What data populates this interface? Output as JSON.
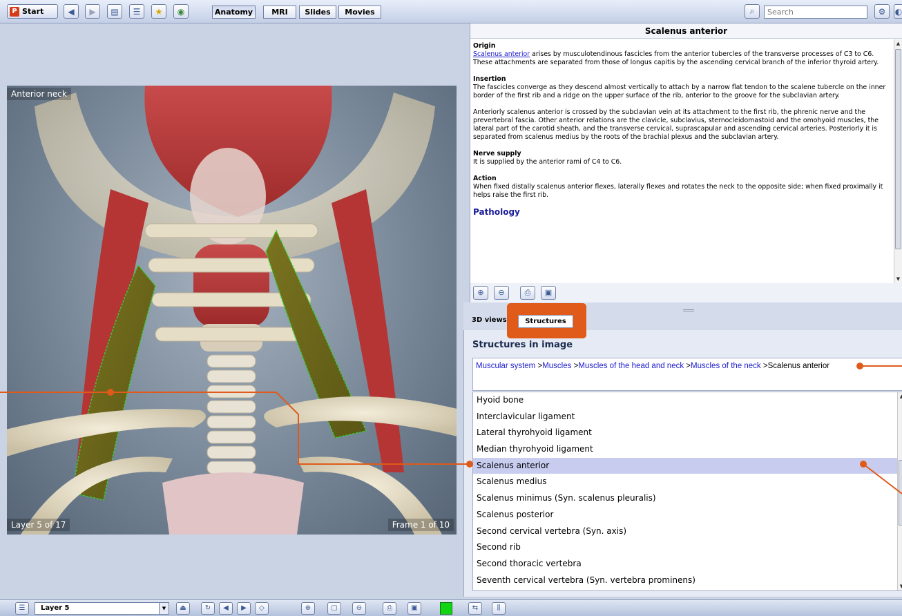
{
  "toolbar": {
    "start_label": "Start",
    "logo_letter": "P",
    "tabs": [
      "Anatomy",
      "MRI",
      "Slides",
      "Movies"
    ],
    "active_tab": "Anatomy",
    "search_placeholder": "Search"
  },
  "viewer": {
    "view_label": "Anterior neck",
    "layer_label": "Layer 5 of 17",
    "frame_label": "Frame 1 of 10"
  },
  "description": {
    "title": "Scalenus anterior",
    "origin_heading": "Origin",
    "origin_link": "Scalenus anterior",
    "origin_text": " arises by musculotendinous fascicles from the anterior tubercles of the transverse processes of C3 to C6. These attachments are separated from those of longus capitis by the ascending cervical branch of the inferior thyroid artery.",
    "insertion_heading": "Insertion",
    "insertion_text": "The fascicles converge as they descend almost vertically to attach by a narrow flat tendon to the scalene tubercle on the inner border of the first rib and a ridge on the upper surface of the rib, anterior to the groove for the subclavian artery.",
    "relations_text": "Anteriorly scalenus anterior is crossed by the subclavian vein at its attachment to the first rib, the phrenic nerve and the prevertebral fascia. Other anterior relations are the clavicle, subclavius, sternocleidomastoid and the omohyoid muscles, the lateral part of the carotid sheath, and the transverse cervical, suprascapular and ascending cervical arteries. Posteriorly it is separated from scalenus medius by the roots of the brachial plexus and the subclavian artery.",
    "nerve_heading": "Nerve supply",
    "nerve_text": "It is supplied by the anterior rami of C4 to C6.",
    "action_heading": "Action",
    "action_text": "When fixed distally scalenus anterior flexes, laterally flexes and rotates the neck to the opposite side; when fixed proximally it helps raise the first rib.",
    "pathology_heading": "Pathology"
  },
  "panel_tabs": {
    "views_label": "3D views",
    "structures_label": "Structures"
  },
  "structures": {
    "heading": "Structures in image",
    "breadcrumb": [
      "Muscular system",
      "Muscles",
      "Muscles of the head and neck",
      "Muscles of the neck",
      "Scalenus anterior"
    ],
    "selected": "Scalenus anterior",
    "items": [
      "Hyoid bone",
      "Interclavicular ligament",
      "Lateral thyrohyoid ligament",
      "Median thyrohyoid ligament",
      "Scalenus anterior",
      "Scalenus medius",
      "Scalenus minimus (Syn. scalenus pleuralis)",
      "Scalenus posterior",
      "Second cervical vertebra (Syn. axis)",
      "Second rib",
      "Second thoracic vertebra",
      "Seventh cervical vertebra (Syn. vertebra prominens)"
    ]
  },
  "bottom": {
    "layer_label": "Layer 5"
  },
  "colors": {
    "highlight": "#e05a19",
    "selected_row": "#c8cdf0",
    "link": "#1a1acc",
    "muscle_highlight": "#6b6a1c"
  },
  "icons": {
    "toolbar": [
      "back-arrow-icon",
      "forward-arrow-icon",
      "document-icon",
      "list-icon",
      "star-icon",
      "globe-icon"
    ],
    "search": "magnifier-icon",
    "settings": "gear-icon",
    "description_tools": [
      "zoom-in-icon",
      "zoom-out-icon",
      "print-icon",
      "save-icon"
    ],
    "bottom": [
      "menu-icon",
      "eject-icon",
      "rotate-icon",
      "prev-icon",
      "next-icon",
      "tag-icon",
      "zoom-in-icon",
      "frame-icon",
      "zoom-out-icon",
      "print-icon",
      "save-icon",
      "color-icon",
      "swap-icon",
      "graph-icon"
    ]
  }
}
